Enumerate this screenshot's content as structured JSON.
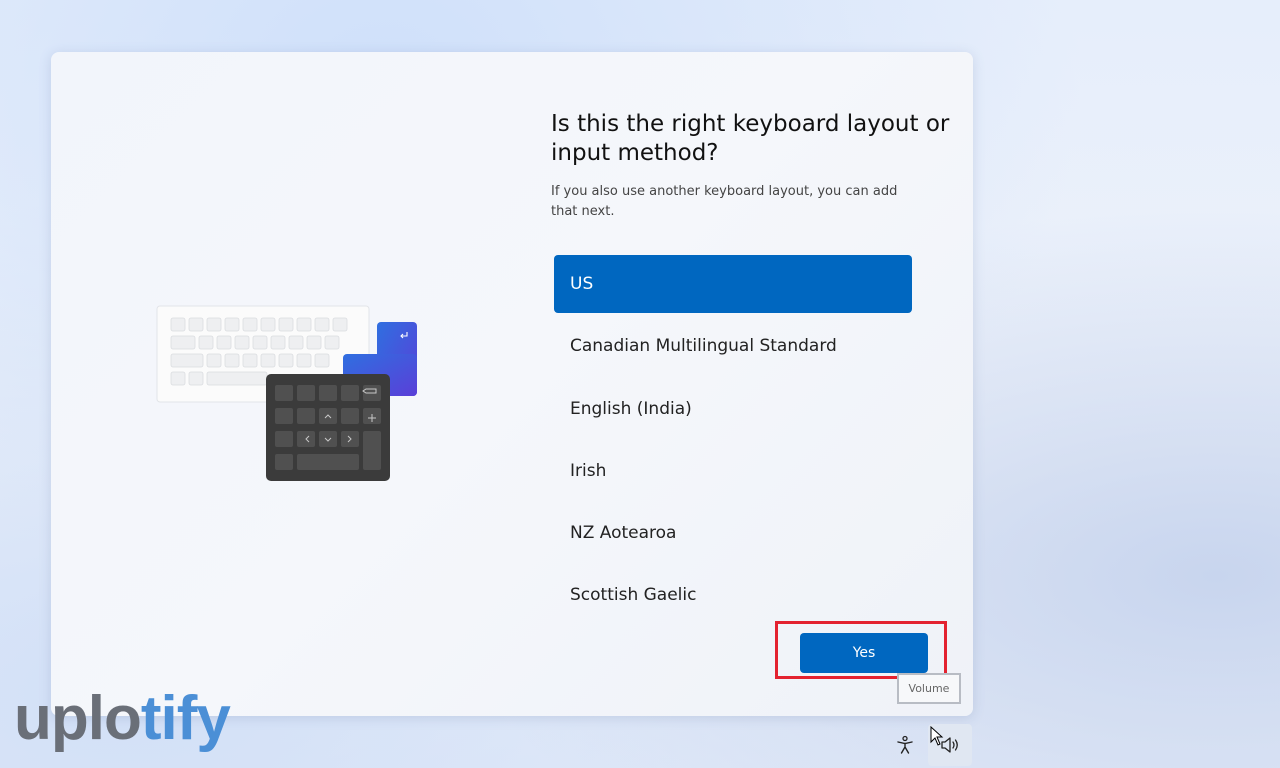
{
  "dialog": {
    "title": "Is this the right keyboard layout or input method?",
    "subtitle": "If you also use another keyboard layout, you can add that next.",
    "layouts": [
      {
        "label": "US",
        "selected": true
      },
      {
        "label": "Canadian Multilingual Standard",
        "selected": false
      },
      {
        "label": "English (India)",
        "selected": false
      },
      {
        "label": "Irish",
        "selected": false
      },
      {
        "label": "NZ Aotearoa",
        "selected": false
      },
      {
        "label": "Scottish Gaelic",
        "selected": false
      }
    ],
    "yes_label": "Yes"
  },
  "tooltip": {
    "text": "Volume"
  },
  "watermark": {
    "part1": "uplo",
    "part2": "tify"
  },
  "tray": {
    "accessibility_icon": "accessibility-icon",
    "volume_icon": "volume-icon"
  },
  "colors": {
    "accent": "#0067c0",
    "highlight": "#e32230",
    "keypad": "#3b3b3b"
  }
}
